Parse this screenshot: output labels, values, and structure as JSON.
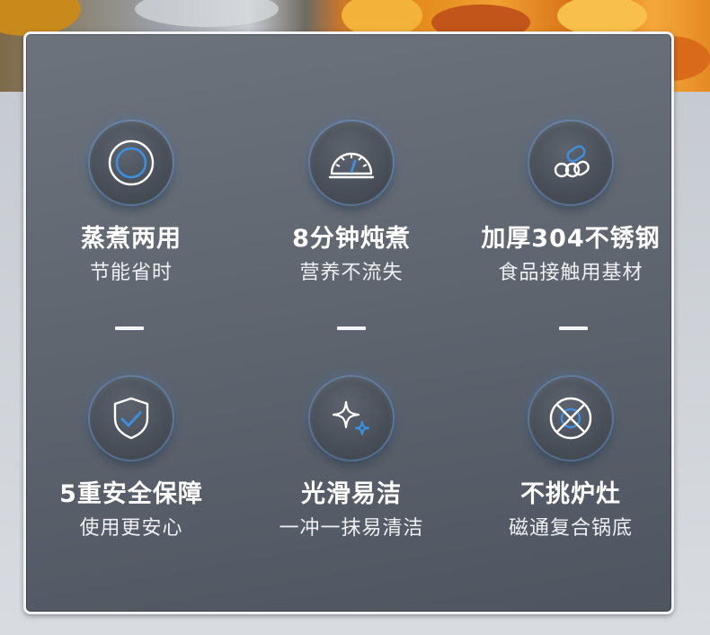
{
  "features": [
    {
      "title": "蒸煮两用",
      "subtitle": "节能省时",
      "icon": "ring-icon"
    },
    {
      "title": "8分钟炖煮",
      "subtitle": "营养不流失",
      "icon": "gauge-icon"
    },
    {
      "title": "加厚304不锈钢",
      "subtitle": "食品接触用基材",
      "icon": "steel-material-icon"
    },
    {
      "title": "5重安全保障",
      "subtitle": "使用更安心",
      "icon": "shield-check-icon"
    },
    {
      "title": "光滑易洁",
      "subtitle": "一冲一抹易清洁",
      "icon": "sparkle-icon"
    },
    {
      "title": "不挑炉灶",
      "subtitle": "磁通复合锅底",
      "icon": "burner-icon"
    }
  ],
  "colors": {
    "accent": "#3d8fe0",
    "card": "#5f6670",
    "text": "#ffffff"
  }
}
